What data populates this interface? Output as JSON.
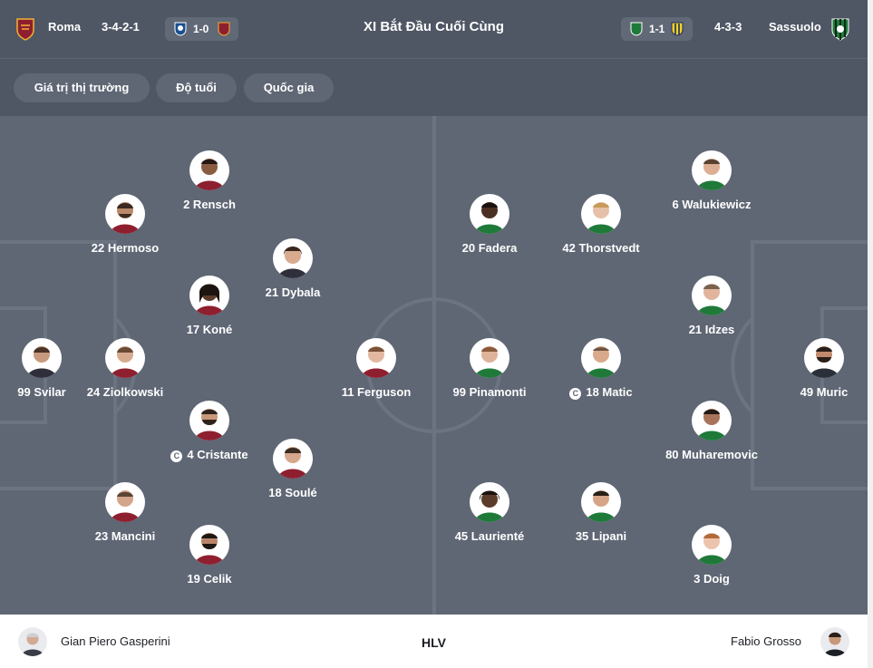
{
  "header": {
    "home_team": "Roma",
    "home_formation": "3-4-2-1",
    "home_last_score": "1-0",
    "title": "XI Bắt Đầu Cuối Cùng",
    "away_last_score": "1-1",
    "away_formation": "4-3-3",
    "away_team": "Sassuolo"
  },
  "filters": [
    "Giá trị thị trường",
    "Độ tuổi",
    "Quốc gia"
  ],
  "home_players": [
    {
      "label": "99 Svilar",
      "captain": false
    },
    {
      "label": "24 Ziolkowski",
      "captain": false
    },
    {
      "label": "22 Hermoso",
      "captain": false
    },
    {
      "label": "23 Mancini",
      "captain": false
    },
    {
      "label": "2 Rensch",
      "captain": false
    },
    {
      "label": "17 Koné",
      "captain": false
    },
    {
      "label": "4 Cristante",
      "captain": true
    },
    {
      "label": "19 Celik",
      "captain": false
    },
    {
      "label": "21 Dybala",
      "captain": false
    },
    {
      "label": "18 Soulé",
      "captain": false
    },
    {
      "label": "11 Ferguson",
      "captain": false
    }
  ],
  "away_players": [
    {
      "label": "99 Pinamonti",
      "captain": false
    },
    {
      "label": "20 Fadera",
      "captain": false
    },
    {
      "label": "45 Laurienté",
      "captain": false
    },
    {
      "label": "42 Thorstvedt",
      "captain": false
    },
    {
      "label": "18 Matic",
      "captain": true
    },
    {
      "label": "35 Lipani",
      "captain": false
    },
    {
      "label": "6 Walukiewicz",
      "captain": false
    },
    {
      "label": "21 Idzes",
      "captain": false
    },
    {
      "label": "80 Muharemovic",
      "captain": false
    },
    {
      "label": "3 Doig",
      "captain": false
    },
    {
      "label": "49 Muric",
      "captain": false
    }
  ],
  "captain_symbol": "C",
  "coaches": {
    "home": "Gian Piero Gasperini",
    "label": "HLV",
    "away": "Fabio Grosso"
  },
  "colors": {
    "header_bg": "#4f5664",
    "pitch_bg": "#5f6674",
    "pitch_lines": "#6c7381",
    "roma": "#8e1f2f",
    "sassuolo": "#1f7a3a"
  }
}
